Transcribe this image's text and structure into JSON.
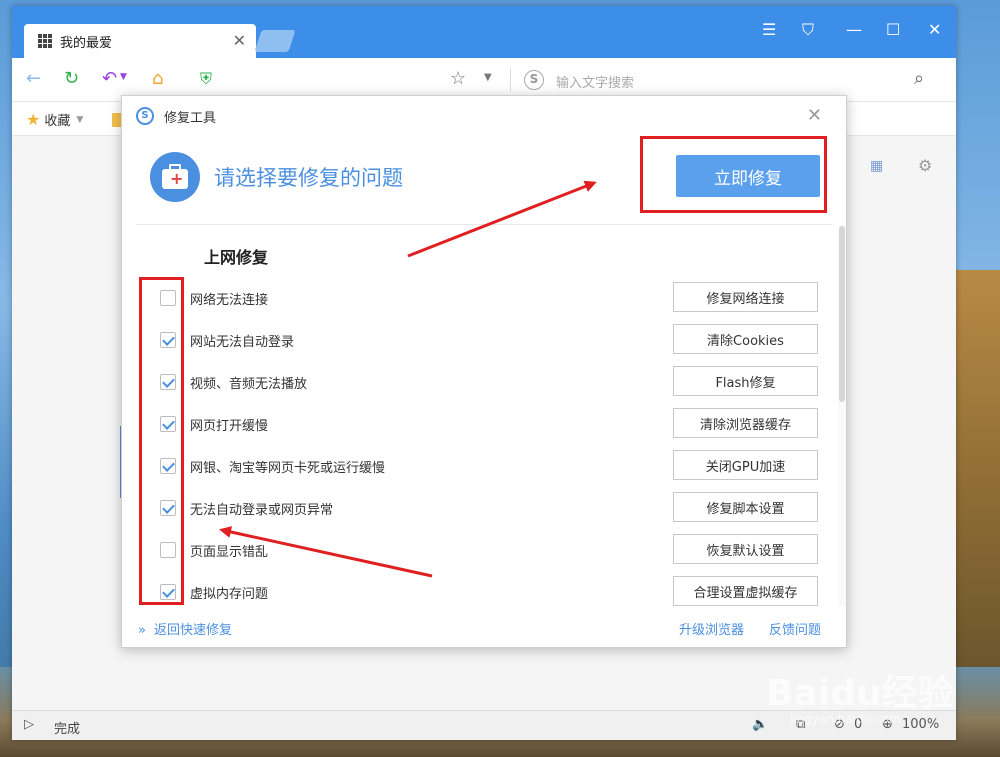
{
  "browser": {
    "tab_title": "我的最爱",
    "search_placeholder": "输入文字搜索",
    "bookmark_favorites": "收藏",
    "status_text": "完成",
    "status_count": "0",
    "zoom": "100%"
  },
  "dialog": {
    "title": "修复工具",
    "heading": "请选择要修复的问题",
    "fix_now_label": "立即修复",
    "section_title": "上网修复",
    "items": [
      {
        "label": "网络无法连接",
        "checked": false,
        "button": "修复网络连接"
      },
      {
        "label": "网站无法自动登录",
        "checked": true,
        "button": "清除Cookies"
      },
      {
        "label": "视频、音频无法播放",
        "checked": true,
        "button": "Flash修复"
      },
      {
        "label": "网页打开缓慢",
        "checked": true,
        "button": "清除浏览器缓存"
      },
      {
        "label": "网银、淘宝等网页卡死或运行缓慢",
        "checked": true,
        "button": "关闭GPU加速"
      },
      {
        "label": "无法自动登录或网页异常",
        "checked": true,
        "button": "修复脚本设置"
      },
      {
        "label": "页面显示错乱",
        "checked": false,
        "button": "恢复默认设置"
      },
      {
        "label": "虚拟内存问题",
        "checked": true,
        "button": "合理设置虚拟缓存"
      }
    ],
    "back_link": "返回快速修复",
    "upgrade_link": "升级浏览器",
    "feedback_link": "反馈问题"
  },
  "watermark": {
    "text": "Baidu经验",
    "sub": "jingyan.baidu.com"
  },
  "colors": {
    "accent": "#4a8fe0",
    "titlebar": "#3d8ee8",
    "annotation": "#e02020"
  }
}
